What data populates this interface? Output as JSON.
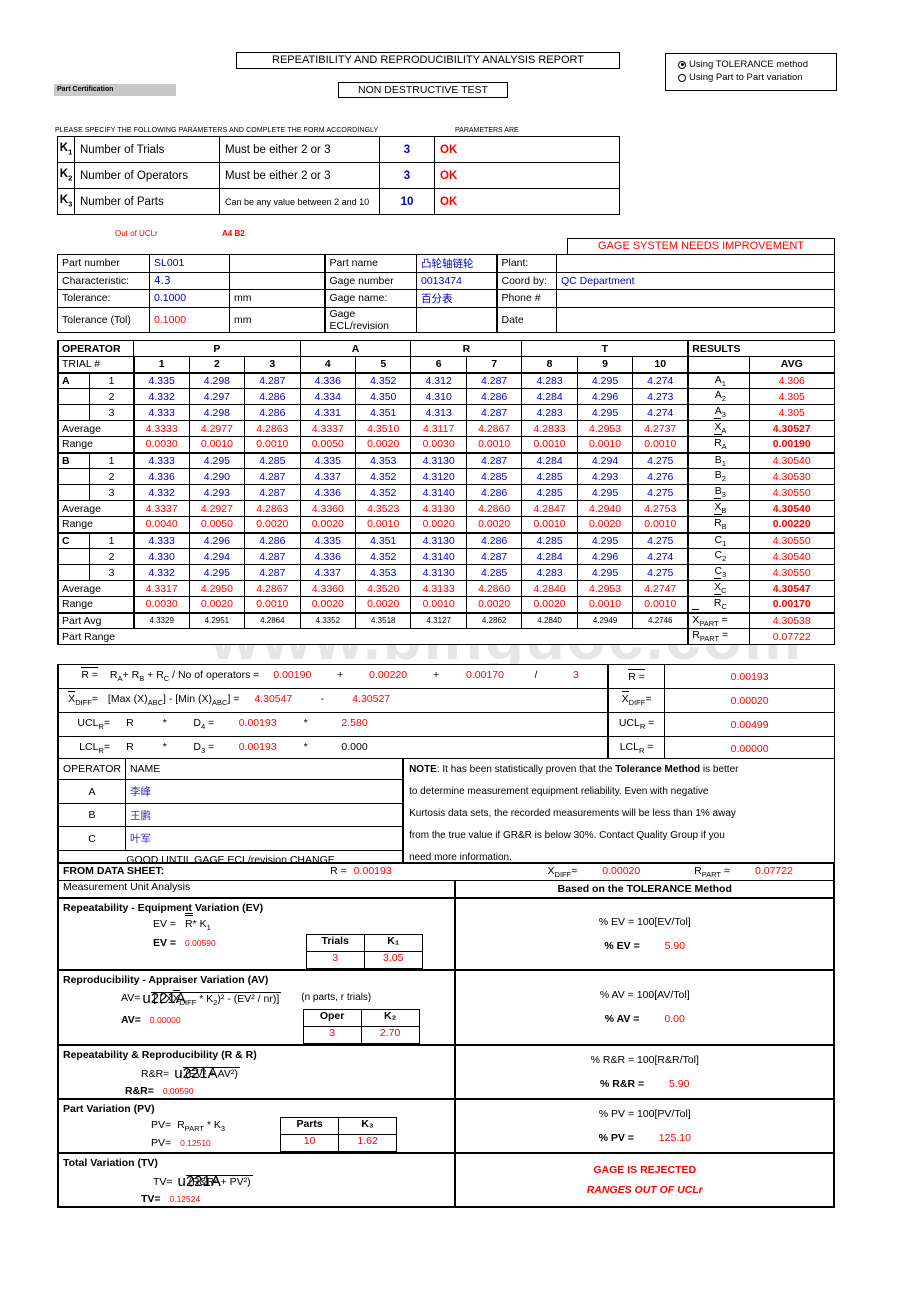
{
  "header": {
    "title": "REPEATIBILITY AND REPRODUCIBILITY ANALYSIS REPORT",
    "test_type": "NON DESTRUCTIVE TEST",
    "part_certification": "Part Certification",
    "method_options": [
      {
        "label": "Using TOLERANCE method",
        "selected": true
      },
      {
        "label": "Using Part to Part variation",
        "selected": false
      }
    ]
  },
  "params": {
    "instruction": "PLEASE SPECIFY THE FOLLOWING PARAMETERS AND COMPLETE THE FORM ACCORDINGLY",
    "parameters_are": "PARAMETERS ARE",
    "rows": [
      {
        "code": "K",
        "sub": "1",
        "name": "Number of Trials",
        "desc": "Must be either 2 or 3",
        "value": "3",
        "status": "OK"
      },
      {
        "code": "K",
        "sub": "2",
        "name": "Number of Operators",
        "desc": "Must be either 2 or 3",
        "value": "3",
        "status": "OK"
      },
      {
        "code": "K",
        "sub": "3",
        "name": "Number of Parts",
        "desc": "Can be any value between 2 and 10",
        "value": "10",
        "status": "OK"
      }
    ]
  },
  "alerts": {
    "out_of_uclr": "Out of UCLr",
    "a4b2": "A4 B2",
    "gage_system": "GAGE SYSTEM NEEDS IMPROVEMENT"
  },
  "info": {
    "left": [
      {
        "label": "Part number",
        "value": "SL001",
        "unit": ""
      },
      {
        "label": "Characteristic:",
        "value": "4.3",
        "unit": ""
      },
      {
        "label": "Tolerance:",
        "value": "0.1000",
        "unit": "mm"
      },
      {
        "label": "Tolerance (Tol)",
        "value": "0.1000",
        "unit": "mm"
      }
    ],
    "middle": [
      {
        "label": "Part name",
        "value": "凸轮轴链轮"
      },
      {
        "label": "Gage number",
        "value": "0013474"
      },
      {
        "label": "Gage name:",
        "value": "百分表"
      },
      {
        "label": "Gage ECL/revision",
        "value": ""
      }
    ],
    "right": [
      {
        "label": "Plant:",
        "value": ""
      },
      {
        "label": "Coord by:",
        "value": "QC Department"
      },
      {
        "label": "Phone #",
        "value": ""
      },
      {
        "label": "Date",
        "value": ""
      }
    ]
  },
  "grid": {
    "operator_label": "OPERATOR",
    "trial_label": "TRIAL #",
    "part_word": [
      "P",
      "A",
      "R",
      "T"
    ],
    "part_numbers": [
      "1",
      "2",
      "3",
      "4",
      "5",
      "6",
      "7",
      "8",
      "9",
      "10"
    ],
    "results_label": "RESULTS",
    "avg_label": "AVG",
    "part_avg_label": "Part Avg",
    "part_range_label": "Part Range",
    "average_label": "Average",
    "range_label": "Range",
    "operators": [
      {
        "name": "A",
        "trials": [
          {
            "n": "1",
            "values": [
              "4.335",
              "4.298",
              "4.287",
              "4.336",
              "4.352",
              "4.312",
              "4.287",
              "4.283",
              "4.295",
              "4.274"
            ],
            "res_label": "A",
            "res_sub": "1",
            "res_value": "4.306"
          },
          {
            "n": "2",
            "values": [
              "4.332",
              "4.297",
              "4.286",
              "4.334",
              "4.350",
              "4.310",
              "4.286",
              "4.284",
              "4.296",
              "4.273"
            ],
            "res_label": "A",
            "res_sub": "2",
            "res_value": "4.305"
          },
          {
            "n": "3",
            "values": [
              "4.333",
              "4.298",
              "4.286",
              "4.331",
              "4.351",
              "4.313",
              "4.287",
              "4.283",
              "4.295",
              "4.274"
            ],
            "res_label": "A",
            "res_sub": "3",
            "res_value": "4.305"
          }
        ],
        "average": [
          "4.3333",
          "4.2977",
          "4.2863",
          "4.3337",
          "4.3510",
          "4.3117",
          "4.2867",
          "4.2833",
          "4.2953",
          "4.2737"
        ],
        "range": [
          "0.0030",
          "0.0010",
          "0.0010",
          "0.0050",
          "0.0020",
          "0.0030",
          "0.0010",
          "0.0010",
          "0.0010",
          "0.0010"
        ],
        "xbar_label": "X",
        "xbar_sub": "A",
        "xbar_value": "4.30527",
        "rbar_label": "R",
        "rbar_sub": "A",
        "rbar_value": "0.00190"
      },
      {
        "name": "B",
        "trials": [
          {
            "n": "1",
            "values": [
              "4.333",
              "4.295",
              "4.285",
              "4.335",
              "4.353",
              "4.3130",
              "4.287",
              "4.284",
              "4.294",
              "4.275"
            ],
            "res_label": "B",
            "res_sub": "1",
            "res_value": "4.30540"
          },
          {
            "n": "2",
            "values": [
              "4.336",
              "4.290",
              "4.287",
              "4.337",
              "4.352",
              "4.3120",
              "4.285",
              "4.285",
              "4.293",
              "4.276"
            ],
            "res_label": "B",
            "res_sub": "2",
            "res_value": "4.30530"
          },
          {
            "n": "3",
            "values": [
              "4.332",
              "4.293",
              "4.287",
              "4.336",
              "4.352",
              "4.3140",
              "4.286",
              "4.285",
              "4.295",
              "4.275"
            ],
            "res_label": "B",
            "res_sub": "3",
            "res_value": "4.30550"
          }
        ],
        "average": [
          "4.3337",
          "4.2927",
          "4.2863",
          "4.3360",
          "4.3523",
          "4.3130",
          "4.2860",
          "4.2847",
          "4.2940",
          "4.2753"
        ],
        "range": [
          "0.0040",
          "0.0050",
          "0.0020",
          "0.0020",
          "0.0010",
          "0.0020",
          "0.0020",
          "0.0010",
          "0.0020",
          "0.0010"
        ],
        "xbar_label": "X",
        "xbar_sub": "B",
        "xbar_value": "4.30540",
        "rbar_label": "R",
        "rbar_sub": "B",
        "rbar_value": "0.00220"
      },
      {
        "name": "C",
        "trials": [
          {
            "n": "1",
            "values": [
              "4.333",
              "4.296",
              "4.286",
              "4.335",
              "4.351",
              "4.3130",
              "4.286",
              "4.285",
              "4.295",
              "4.275"
            ],
            "res_label": "C",
            "res_sub": "1",
            "res_value": "4.30550"
          },
          {
            "n": "2",
            "values": [
              "4.330",
              "4.294",
              "4.287",
              "4.336",
              "4.352",
              "4.3140",
              "4.287",
              "4.284",
              "4.296",
              "4.274"
            ],
            "res_label": "C",
            "res_sub": "2",
            "res_value": "4.30540"
          },
          {
            "n": "3",
            "values": [
              "4.332",
              "4.295",
              "4.287",
              "4.337",
              "4.353",
              "4.3130",
              "4.285",
              "4.283",
              "4.295",
              "4.275"
            ],
            "res_label": "C",
            "res_sub": "3",
            "res_value": "4.30550"
          }
        ],
        "average": [
          "4.3317",
          "4.2950",
          "4.2867",
          "4.3360",
          "4.3520",
          "4.3133",
          "4.2860",
          "4.2840",
          "4.2953",
          "4.2747"
        ],
        "range": [
          "0.0030",
          "0.0020",
          "0.0010",
          "0.0020",
          "0.0020",
          "0.0010",
          "0.0020",
          "0.0020",
          "0.0010",
          "0.0010"
        ],
        "xbar_label": "X",
        "xbar_sub": "C",
        "xbar_value": "4.30547",
        "rbar_label": "R",
        "rbar_sub": "C",
        "rbar_value": "0.00170"
      }
    ],
    "part_avg": [
      "4.3329",
      "4.2951",
      "4.2864",
      "4.3352",
      "4.3518",
      "4.3127",
      "4.2862",
      "4.2840",
      "4.2949",
      "4.2746"
    ],
    "xpart_label": "X",
    "xpart_sub": "PART",
    "xpart_value": "4.30538",
    "rpart_label": "R",
    "rpart_sub": "PART",
    "rpart_value": "0.07722"
  },
  "formulas": {
    "rbar": {
      "lead": "R =",
      "expr": "R",
      "expr_a_sub": "A",
      "plus1": "+",
      "expr_b": "R",
      "expr_b_sub": "B",
      "plus2": "+",
      "expr_c": "R",
      "expr_c_sub": "C",
      "divtext": "/ No of operators =",
      "v1": "0.00190",
      "op1": "+",
      "v2": "0.00220",
      "op2": "+",
      "v3": "0.00170",
      "op3": "/",
      "v4": "3",
      "result_label": "R =",
      "result": "0.00193"
    },
    "xdiff": {
      "lead": "X",
      "lead_sub": "DIFF",
      "eq": "=",
      "expr": "[Max (X)",
      "expr_sub": "ABC",
      "expr2": "]  -  [Min (X)",
      "expr2_sub": "ABC",
      "expr3": "]  =",
      "v1": "4.30547",
      "op1": "-",
      "v2": "4.30527",
      "result_label": "X",
      "result_sub": "DIFF",
      "result_eq": "=",
      "result": "0.00020"
    },
    "uclr": {
      "lead": "UCL",
      "lead_sub": "R",
      "eq": "=",
      "rbar": "R",
      "star1": "*",
      "d": "D",
      "d_sub": "4",
      "eq2": "=",
      "v1": "0.00193",
      "op1": "*",
      "v2": "2.580",
      "result_label": "UCL",
      "result_sub": "R",
      "result_eq": "=",
      "result": "0.00499"
    },
    "lclr": {
      "lead": "LCL",
      "lead_sub": "R",
      "eq": "=",
      "rbar": "R",
      "star1": "*",
      "d": "D",
      "d_sub": "3",
      "eq2": "=",
      "v1": "0.00193",
      "op1": "*",
      "v2": "0.000",
      "result_label": "LCL",
      "result_sub": "R",
      "result_eq": "=",
      "result": "0.00000"
    }
  },
  "operators_table": {
    "col1": "OPERATOR",
    "col2": "NAME",
    "rows": [
      {
        "code": "A",
        "name": "李峰"
      },
      {
        "code": "B",
        "name": "王鹏"
      },
      {
        "code": "C",
        "name": "叶军"
      }
    ],
    "footer": "GOOD UNTIL GAGE ECL/revision CHANGE"
  },
  "note": {
    "prefix": "NOTE",
    "line1_a": ": It has been statistically proven that the ",
    "line1_bold": "Tolerance Method",
    "line1_b": " is better",
    "line2": "to determine measurement equipment reliability. Even with negative",
    "line3": "Kurtosis data sets, the recorded measurements will be less than 1% away",
    "line4": "from the true value if GR&R is below 30%. Contact Quality Group if you",
    "line5": "need more information."
  },
  "from_data_sheet": {
    "label": "FROM DATA SHEET:",
    "rbar_label": "R =",
    "rbar_value": "0.00193",
    "xdiff_label": "X",
    "xdiff_sub": "DIFF",
    "xdiff_eq": "=",
    "xdiff_value": "0.00020",
    "rpart_label": "R",
    "rpart_sub": "PART",
    "rpart_eq": "=",
    "rpart_value": "0.07722"
  },
  "analysis": {
    "left_header": "Measurement Unit Analysis",
    "right_header": "Based on the TOLERANCE Method",
    "ev": {
      "title": "Repeatability - Equipment Variation (EV)",
      "formula_lead": "EV =",
      "formula_r": "R",
      "formula_star": "* K",
      "formula_k_sub": "1",
      "value_label": "EV =",
      "value": "0.00590",
      "sub_headers": [
        "Trials",
        "K₁"
      ],
      "sub_values": [
        "3",
        "3.05"
      ],
      "pct_formula": "% EV = 100[EV/Tol]",
      "pct_label": "% EV =",
      "pct_value": "5.90"
    },
    "av": {
      "title": "Reproducibility - Appraiser Variation (AV)",
      "formula_lead": "AV=",
      "formula_body": "[ ( X",
      "formula_sub": "DIFF",
      "formula_body2": " * K",
      "formula_k_sub": "2",
      "formula_body3": ")² - (EV² / nr)]",
      "note": "(n parts, r trials)",
      "value_label": "AV=",
      "value": "0.00000",
      "sub_headers": [
        "Oper",
        "K₂"
      ],
      "sub_values": [
        "3",
        "2.70"
      ],
      "pct_formula": "% AV = 100[AV/Tol]",
      "pct_label": "% AV =",
      "pct_value": "0.00"
    },
    "rr": {
      "title": "Repeatability & Reproducibility (R & R)",
      "formula_lead": "R&R=",
      "formula_body": "(EV² + AV²)",
      "value_label": "R&R=",
      "value": "0.00590",
      "pct_formula": "% R&R = 100[R&R/Tol]",
      "pct_label": "% R&R =",
      "pct_value": "5.90"
    },
    "pv": {
      "title": "Part Variation (PV)",
      "formula_lead": "PV=",
      "formula_r": "R",
      "formula_r_sub": "PART",
      "formula_k": " * K",
      "formula_k_sub": "3",
      "value_label": "PV=",
      "value": "0.12510",
      "sub_headers": [
        "Parts",
        "K₃"
      ],
      "sub_values": [
        "10",
        "1.62"
      ],
      "pct_formula": "% PV = 100[PV/Tol]",
      "pct_label": "% PV =",
      "pct_value": "125.10"
    },
    "tv": {
      "title": "Total Variation (TV)",
      "formula_lead": "TV=",
      "formula_body": "(R&R² + PV²)",
      "value_label": "TV=",
      "value": "0.12524",
      "verdict1": "GAGE IS REJECTED",
      "verdict2": "RANGES OUT OF UCLr"
    }
  },
  "watermark": "www.bingdoc.com",
  "colors": {
    "measured": "#0000cc",
    "calculated": "#ff0000",
    "text": "#000000"
  }
}
